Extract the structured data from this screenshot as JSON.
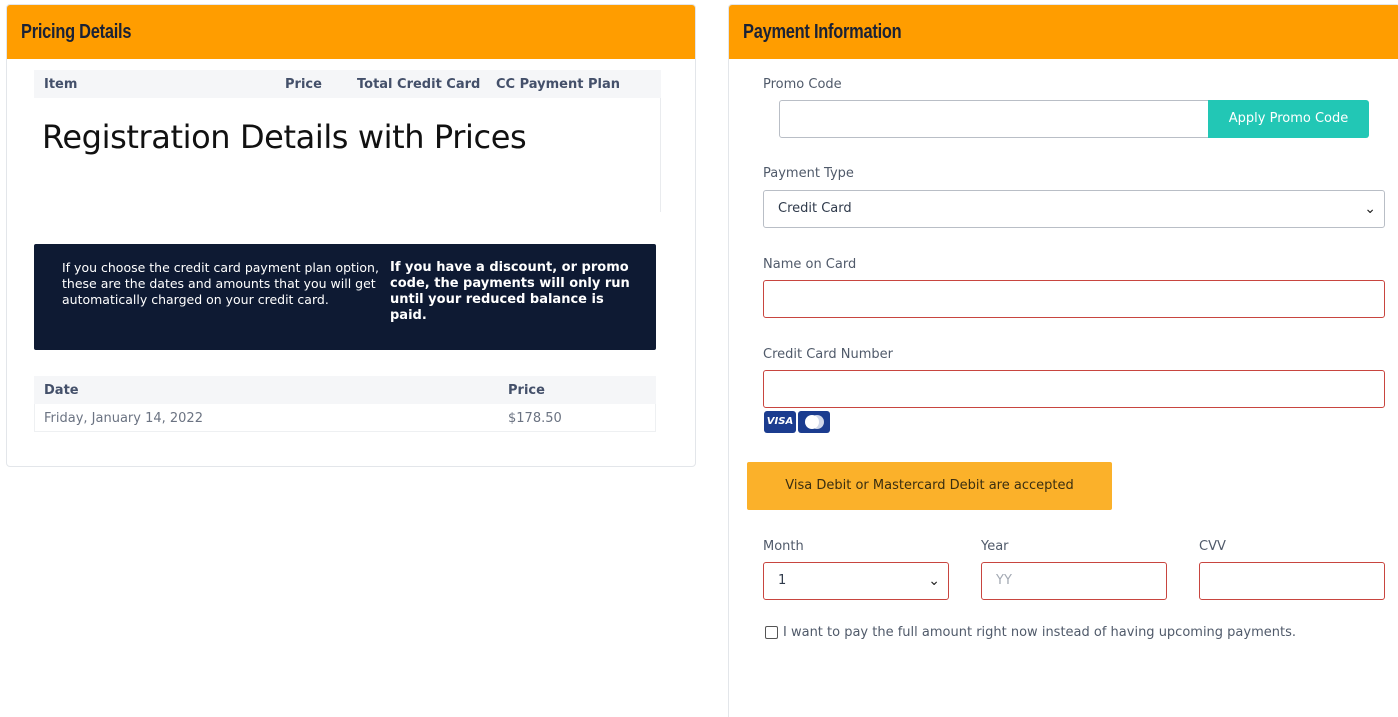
{
  "pricing": {
    "title": "Pricing Details",
    "columns": [
      "Item",
      "Price",
      "Total Credit Card",
      "CC Payment Plan"
    ],
    "placeholder_text": "Registration Details with Prices",
    "info_left": "If you choose the credit card payment plan option, these are the dates and amounts that you will get automatically charged on your credit card.",
    "info_right": "If you have a discount, or promo code, the payments will only run until your reduced balance is paid.",
    "schedule_columns": [
      "Date",
      "Price"
    ],
    "schedule_rows": [
      {
        "date": "Friday, January 14, 2022",
        "price": "$178.50"
      }
    ]
  },
  "payment": {
    "title": "Payment Information",
    "promo_label": "Promo Code",
    "promo_value": "",
    "promo_button": "Apply Promo Code",
    "type_label": "Payment Type",
    "type_value": "Credit Card",
    "name_label": "Name on Card",
    "name_value": "",
    "card_label": "Credit Card Number",
    "card_value": "",
    "card_icons": [
      "visa-icon",
      "mastercard-icon"
    ],
    "visa_text": "VISA",
    "debit_notice": "Visa Debit or Mastercard Debit are accepted",
    "month_label": "Month",
    "month_value": "1",
    "year_label": "Year",
    "year_placeholder": "YY",
    "cvv_label": "CVV",
    "cvv_value": "",
    "full_pay_label": "I want to pay the full amount right now instead of having upcoming payments.",
    "full_pay_checked": false
  },
  "colors": {
    "header": "#ff9d00",
    "info_box": "#0e1a33",
    "promo_button": "#22c7b5",
    "notice": "#fbb12a",
    "error_border": "#c8453f"
  }
}
